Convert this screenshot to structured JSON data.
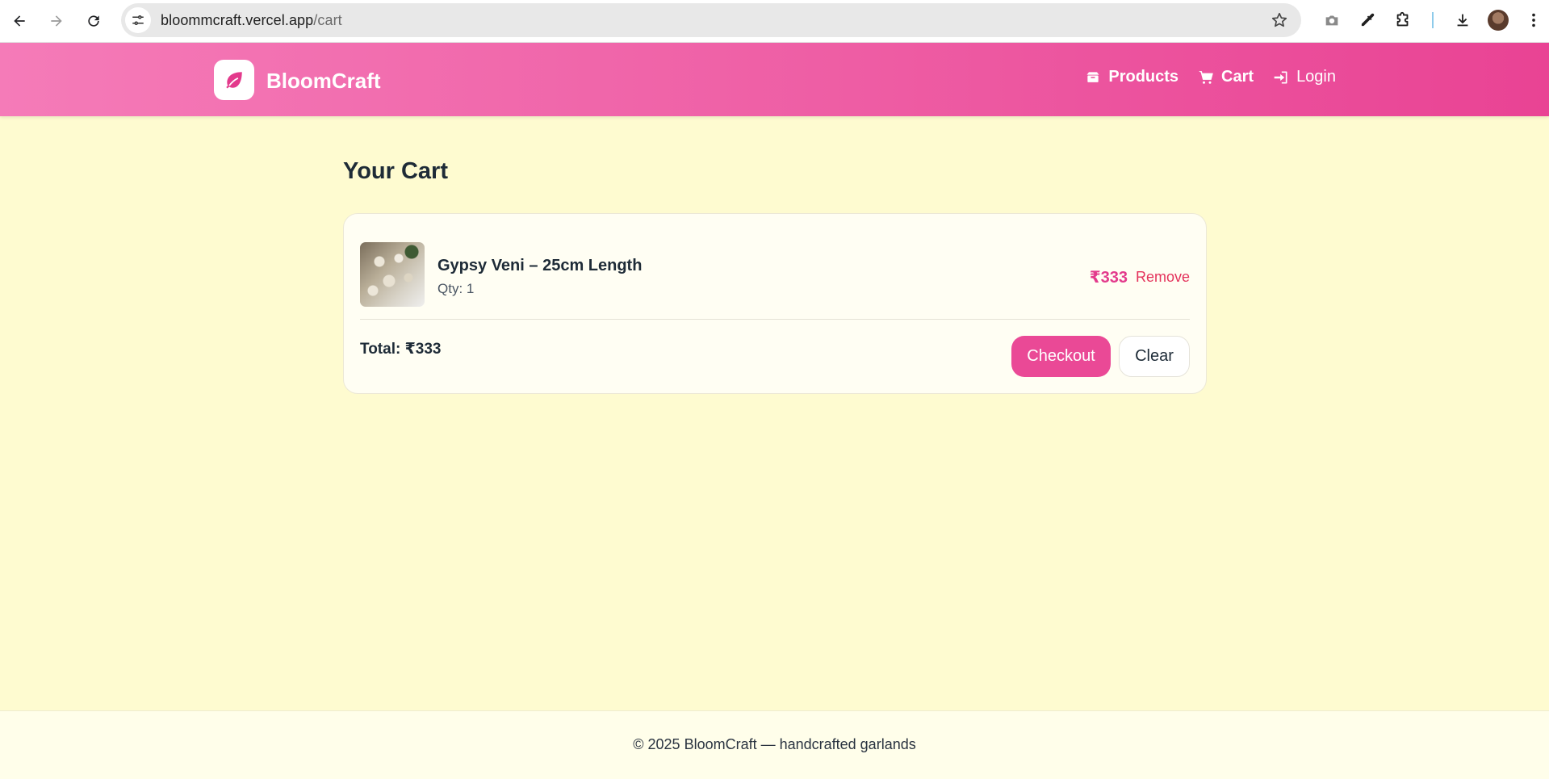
{
  "browser": {
    "url_host": "bloommcraft.vercel.app",
    "url_path": "/cart"
  },
  "header": {
    "brand": "BloomCraft",
    "nav": {
      "products": "Products",
      "cart": "Cart",
      "login": "Login"
    }
  },
  "main": {
    "title": "Your Cart",
    "items": [
      {
        "name": "Gypsy Veni – 25cm Length",
        "qty": "Qty: 1",
        "price": "₹333",
        "remove_label": "Remove"
      }
    ],
    "total": "Total: ₹333",
    "checkout_label": "Checkout",
    "clear_label": "Clear"
  },
  "footer": {
    "text": "© 2025 BloomCraft — handcrafted garlands"
  },
  "colors": {
    "header_gradient_start": "#f57bb8",
    "header_gradient_end": "#e94394",
    "page_background": "#fefbd0",
    "accent": "#ea4996",
    "remove": "#e4335c"
  },
  "icons": {
    "logo": "leaf-icon",
    "products": "box-icon",
    "cart": "cart-icon",
    "login": "sign-in-icon"
  }
}
